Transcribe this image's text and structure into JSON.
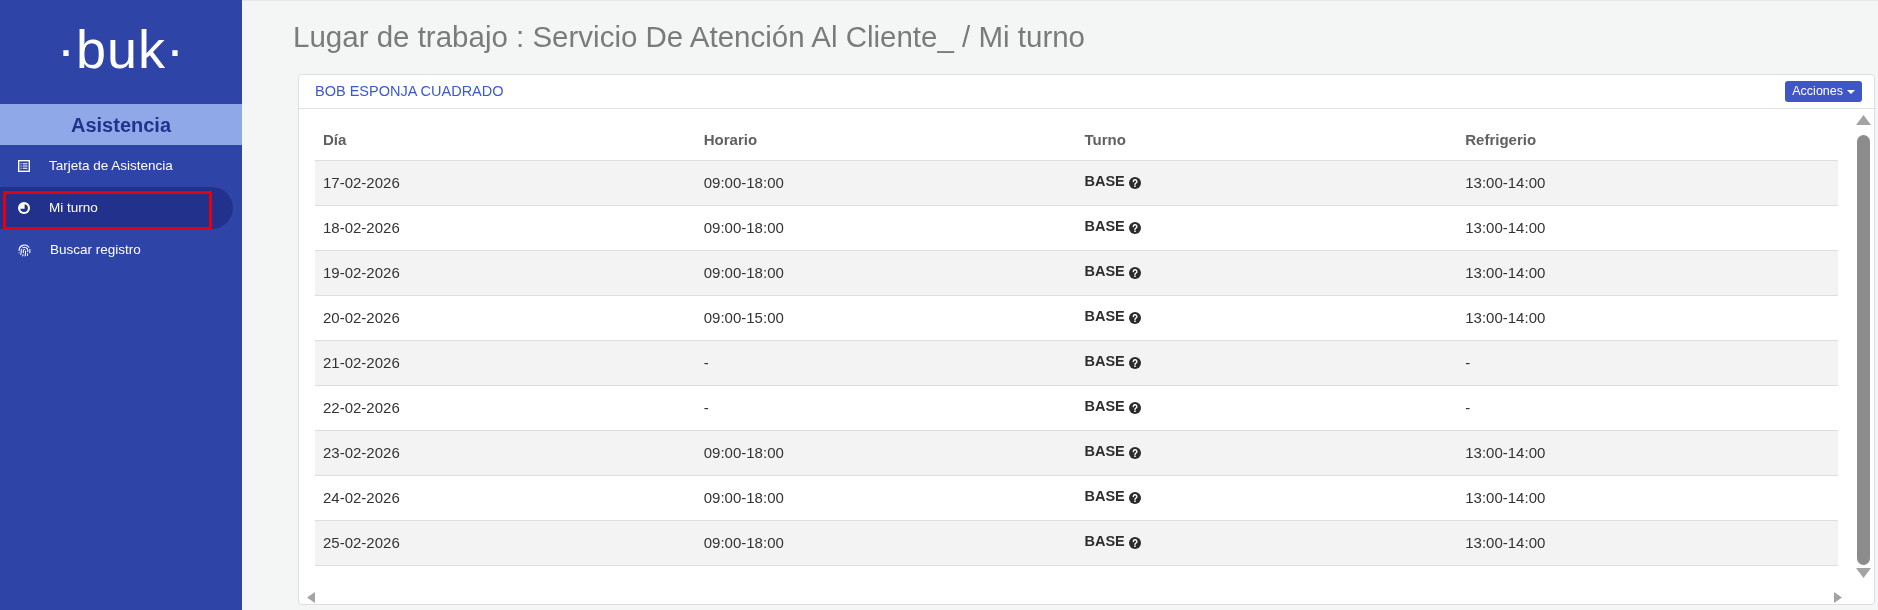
{
  "sidebar": {
    "logo": "·buk·",
    "section_title": "Asistencia",
    "items": [
      {
        "label": "Tarjeta de Asistencia",
        "selected": false,
        "highlighted": false
      },
      {
        "label": "Mi turno",
        "selected": true,
        "highlighted": true
      },
      {
        "label": "Buscar registro",
        "selected": false,
        "highlighted": false
      }
    ]
  },
  "page_title": "Lugar de trabajo : Servicio De Atención Al Cliente_ / Mi turno",
  "card": {
    "title": "BOB ESPONJA CUADRADO",
    "actions_button": "Acciones",
    "table": {
      "columns": [
        "Día",
        "Horario",
        "Turno",
        "Refrigerio"
      ],
      "rows": [
        [
          "17-02-2026",
          "09:00-18:00",
          "BASE",
          "13:00-14:00"
        ],
        [
          "18-02-2026",
          "09:00-18:00",
          "BASE",
          "13:00-14:00"
        ],
        [
          "19-02-2026",
          "09:00-18:00",
          "BASE",
          "13:00-14:00"
        ],
        [
          "20-02-2026",
          "09:00-15:00",
          "BASE",
          "13:00-14:00"
        ],
        [
          "21-02-2026",
          "-",
          "BASE",
          "-"
        ],
        [
          "22-02-2026",
          "-",
          "BASE",
          "-"
        ],
        [
          "23-02-2026",
          "09:00-18:00",
          "BASE",
          "13:00-14:00"
        ],
        [
          "24-02-2026",
          "09:00-18:00",
          "BASE",
          "13:00-14:00"
        ],
        [
          "25-02-2026",
          "09:00-18:00",
          "BASE",
          "13:00-14:00"
        ]
      ]
    }
  }
}
